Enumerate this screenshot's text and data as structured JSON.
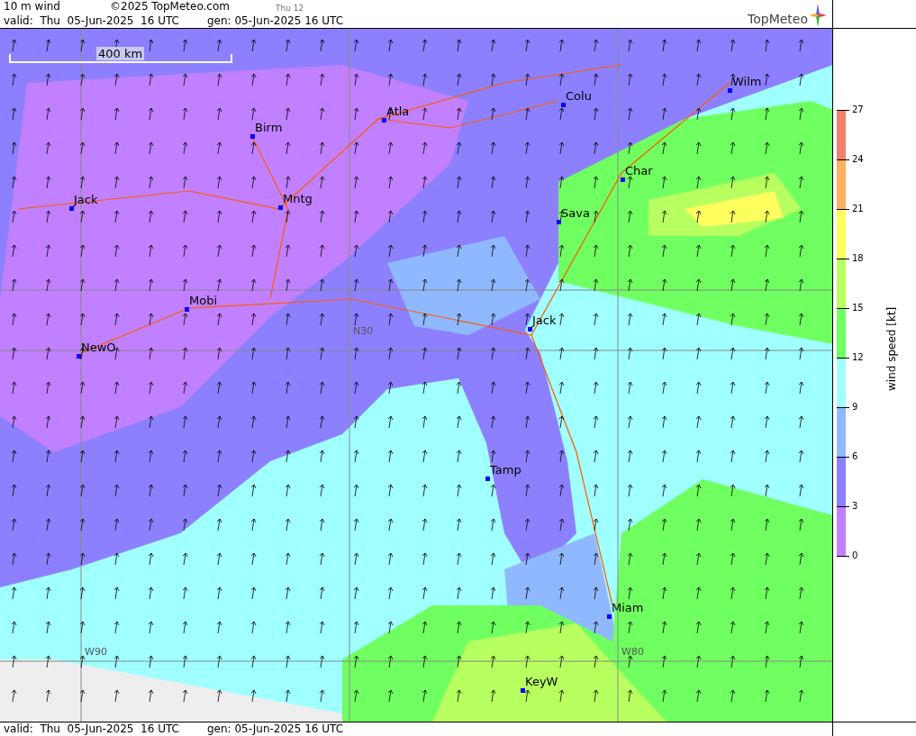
{
  "header": {
    "title": "10 m wind",
    "copyright": "©2025 TopMeteo.com",
    "step": "Thu 12",
    "valid": "valid:  Thu  05-Jun-2025  16 UTC",
    "generated": "gen: 05-Jun-2025 16 UTC",
    "logo": "TopMeteo"
  },
  "map": {
    "scale": "400 km",
    "cities": [
      {
        "name": "Colu"
      },
      {
        "name": "Wilm"
      },
      {
        "name": "Atla"
      },
      {
        "name": "Birm"
      },
      {
        "name": "Char"
      },
      {
        "name": "Jack"
      },
      {
        "name": "Mntg"
      },
      {
        "name": "Sava"
      },
      {
        "name": "Mobi"
      },
      {
        "name": "Jack"
      },
      {
        "name": "NewO"
      },
      {
        "name": "Tamp"
      },
      {
        "name": "Miam"
      },
      {
        "name": "KeyW"
      }
    ],
    "grid_labels": [
      "N30",
      "W90",
      "W80"
    ]
  },
  "legend": {
    "title": "wind speed [kt]",
    "ticks": [
      "27",
      "24",
      "21",
      "18",
      "15",
      "12",
      "9",
      "6",
      "3",
      "0"
    ],
    "bands": [
      {
        "color": "#f08070"
      },
      {
        "color": "#ffb060"
      },
      {
        "color": "#ffff60"
      },
      {
        "color": "#b8ff60"
      },
      {
        "color": "#70ff60"
      },
      {
        "color": "#a0ffff"
      },
      {
        "color": "#90b8ff"
      },
      {
        "color": "#8c80ff"
      },
      {
        "color": "#c080ff"
      }
    ]
  },
  "footer": {
    "valid": "valid:  Thu  05-Jun-2025  16 UTC",
    "generated": "gen: 05-Jun-2025 16 UTC"
  }
}
